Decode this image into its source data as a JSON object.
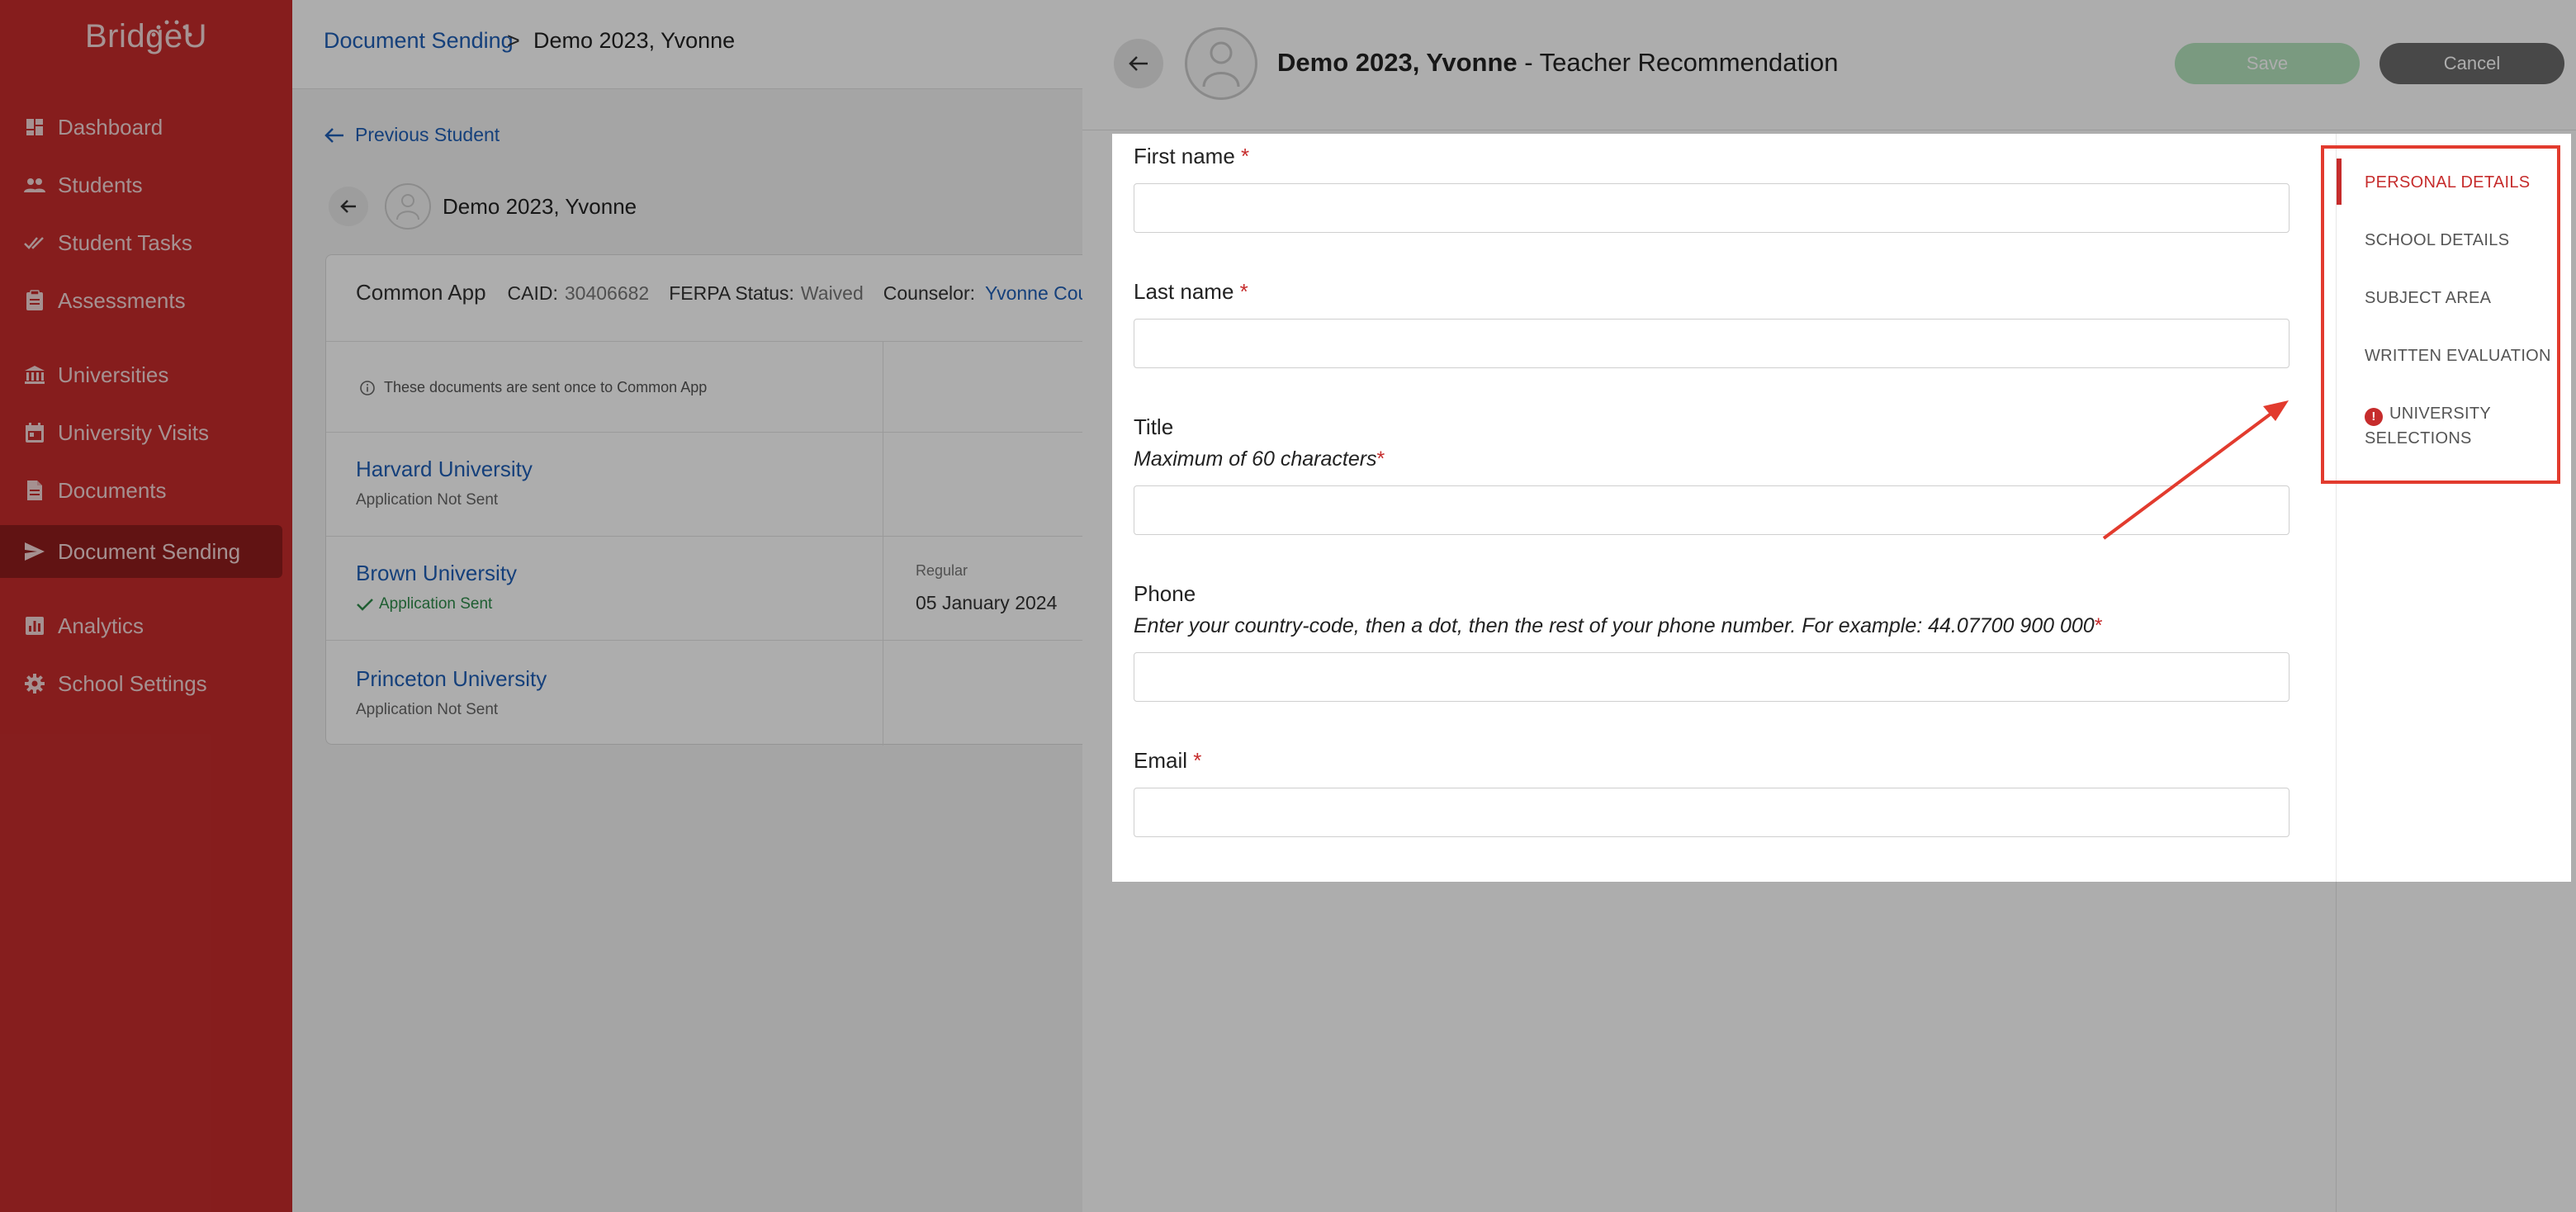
{
  "app": {
    "logo": "BridgeU"
  },
  "sidebar": {
    "items": [
      {
        "label": "Dashboard",
        "icon": "dashboard-icon"
      },
      {
        "label": "Students",
        "icon": "people-icon"
      },
      {
        "label": "Student Tasks",
        "icon": "double-check-icon"
      },
      {
        "label": "Assessments",
        "icon": "clipboard-icon"
      },
      {
        "label": "Universities",
        "icon": "institution-icon"
      },
      {
        "label": "University Visits",
        "icon": "calendar-icon"
      },
      {
        "label": "Documents",
        "icon": "document-icon"
      },
      {
        "label": "Document Sending",
        "icon": "send-icon",
        "active": true
      },
      {
        "label": "Analytics",
        "icon": "bar-chart-icon"
      },
      {
        "label": "School Settings",
        "icon": "gear-icon"
      }
    ]
  },
  "background": {
    "breadcrumb": {
      "parent": "Document Sending",
      "separator": ">",
      "current": "Demo 2023, Yvonne"
    },
    "previous_student": "Previous Student",
    "student_name": "Demo 2023, Yvonne",
    "card": {
      "app_name": "Common App",
      "caid_label": "CAID:",
      "caid_value": "30406682",
      "ferpa_label": "FERPA Status:",
      "ferpa_value": "Waived",
      "counselor_label": "Counselor:",
      "counselor_value": "Yvonne Counse",
      "note": "These documents are sent once to Common App",
      "universities": [
        {
          "name": "Harvard University",
          "status": "Application Not Sent"
        },
        {
          "name": "Brown University",
          "status": "Application Sent",
          "round": "Regular",
          "date": "05 January 2024"
        },
        {
          "name": "Princeton University",
          "status": "Application Not Sent"
        }
      ]
    }
  },
  "drawer": {
    "student_name": "Demo 2023, Yvonne",
    "title_suffix": " - Teacher Recommendation",
    "save_label": "Save",
    "cancel_label": "Cancel",
    "fields": {
      "first_name": {
        "label": "First name",
        "required": "*",
        "value": ""
      },
      "last_name": {
        "label": "Last name",
        "required": "*",
        "value": ""
      },
      "title": {
        "label": "Title",
        "hint": "Maximum of 60 characters",
        "required": "*",
        "value": ""
      },
      "phone": {
        "label": "Phone",
        "hint": "Enter your country-code, then a dot, then the rest of your phone number. For example: 44.07700 900 000",
        "required": "*",
        "value": ""
      },
      "email": {
        "label": "Email",
        "required": "*",
        "value": ""
      }
    },
    "sections": [
      {
        "label": "PERSONAL DETAILS",
        "active": true
      },
      {
        "label": "SCHOOL DETAILS"
      },
      {
        "label": "SUBJECT AREA"
      },
      {
        "label": "WRITTEN EVALUATION"
      },
      {
        "label_line1": "UNIVERSITY",
        "label_line2": "SELECTIONS",
        "warning": true,
        "warning_icon": "exclamation-icon"
      }
    ]
  },
  "annotation": {
    "highlight_color": "#e23b2e"
  }
}
